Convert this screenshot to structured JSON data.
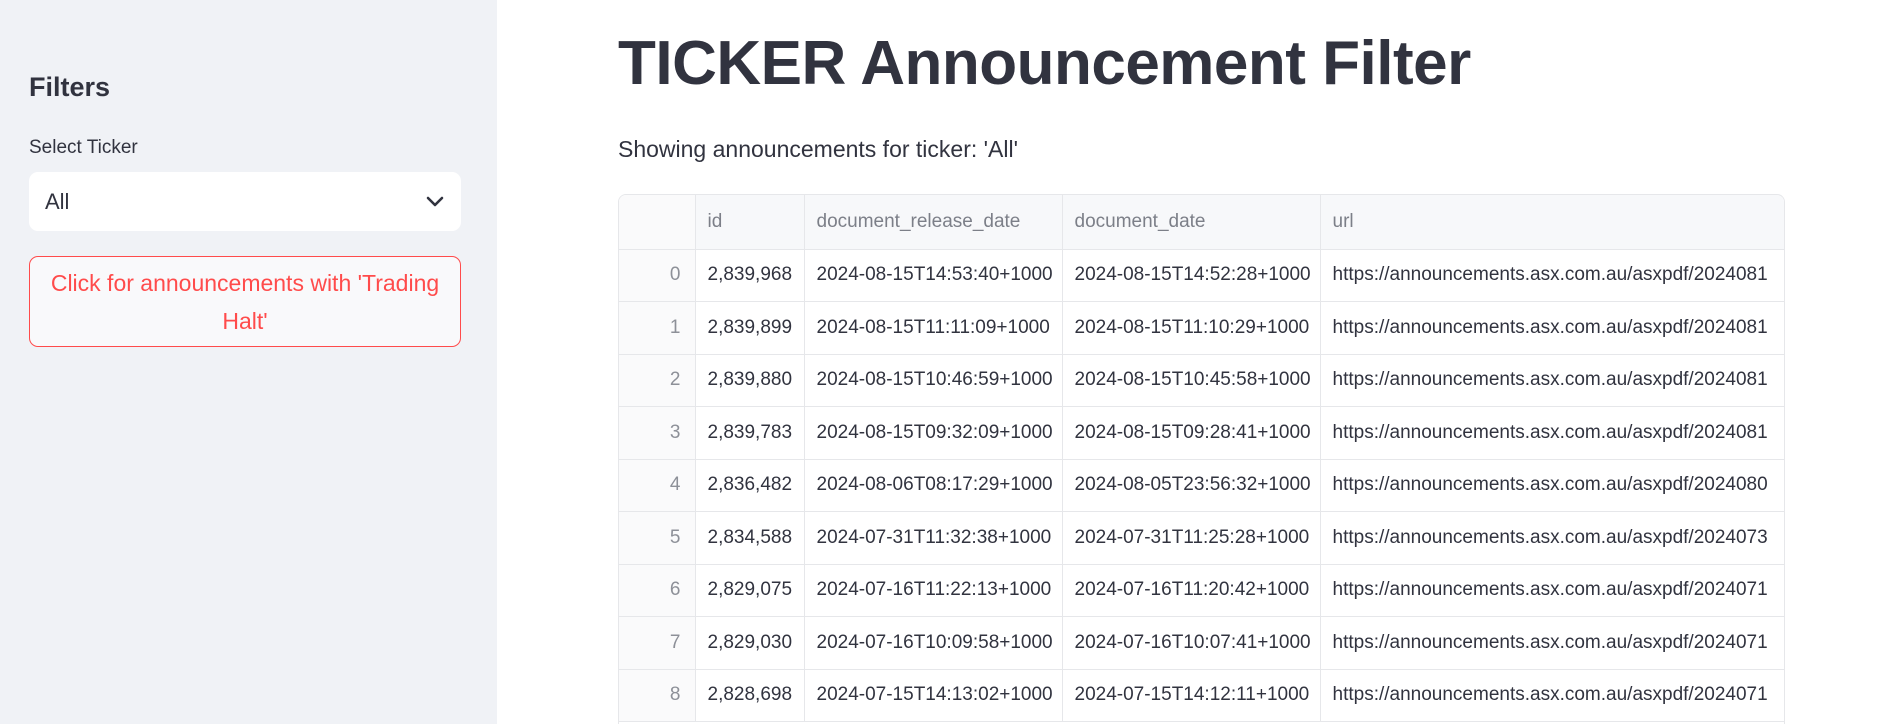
{
  "sidebar": {
    "title": "Filters",
    "select_label": "Select Ticker",
    "select_value": "All",
    "halt_button_label": "Click for announcements with 'Trading Halt'"
  },
  "main": {
    "title": "TICKER Announcement Filter",
    "caption": "Showing announcements for ticker: 'All'"
  },
  "table": {
    "columns": [
      "",
      "id",
      "document_release_date",
      "document_date",
      "url"
    ],
    "rows": [
      [
        "0",
        "2,839,968",
        "2024-08-15T14:53:40+1000",
        "2024-08-15T14:52:28+1000",
        "https://announcements.asx.com.au/asxpdf/2024081"
      ],
      [
        "1",
        "2,839,899",
        "2024-08-15T11:11:09+1000",
        "2024-08-15T11:10:29+1000",
        "https://announcements.asx.com.au/asxpdf/2024081"
      ],
      [
        "2",
        "2,839,880",
        "2024-08-15T10:46:59+1000",
        "2024-08-15T10:45:58+1000",
        "https://announcements.asx.com.au/asxpdf/2024081"
      ],
      [
        "3",
        "2,839,783",
        "2024-08-15T09:32:09+1000",
        "2024-08-15T09:28:41+1000",
        "https://announcements.asx.com.au/asxpdf/2024081"
      ],
      [
        "4",
        "2,836,482",
        "2024-08-06T08:17:29+1000",
        "2024-08-05T23:56:32+1000",
        "https://announcements.asx.com.au/asxpdf/2024080"
      ],
      [
        "5",
        "2,834,588",
        "2024-07-31T11:32:38+1000",
        "2024-07-31T11:25:28+1000",
        "https://announcements.asx.com.au/asxpdf/2024073"
      ],
      [
        "6",
        "2,829,075",
        "2024-07-16T11:22:13+1000",
        "2024-07-16T11:20:42+1000",
        "https://announcements.asx.com.au/asxpdf/2024071"
      ],
      [
        "7",
        "2,829,030",
        "2024-07-16T10:09:58+1000",
        "2024-07-16T10:07:41+1000",
        "https://announcements.asx.com.au/asxpdf/2024071"
      ],
      [
        "8",
        "2,828,698",
        "2024-07-15T14:13:02+1000",
        "2024-07-15T14:12:11+1000",
        "https://announcements.asx.com.au/asxpdf/2024071"
      ]
    ]
  },
  "colors": {
    "sidebar_bg": "#f0f2f6",
    "text": "#31333f",
    "accent_red": "#ff4b4b"
  },
  "icons": {
    "select_chevron": "chevron-down-icon"
  }
}
